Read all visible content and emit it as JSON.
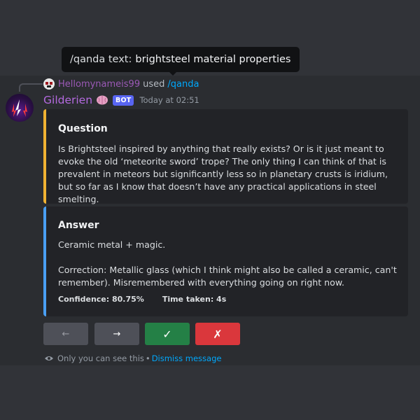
{
  "tooltip": {
    "prefix": "/qanda text:",
    "value": "brightsteel material properties"
  },
  "reply": {
    "username": "Hellomynameis99",
    "action": "used",
    "command": "/qanda"
  },
  "message": {
    "author": "Gilderien",
    "author_emoji": "brain-emoji",
    "badge": "BOT",
    "timestamp": "Today at 02:51"
  },
  "question_embed": {
    "accent": "#f0b232",
    "title": "Question",
    "body": "Is Brightsteel inspired by anything that really exists? Or is it just meant to evoke the old ‘meteorite sword’ trope? The only thing I can think of that is prevalent in meteors but significantly less so in planetary crusts is iridium, but so far as I know that doesn’t have any practical applications in steel smelting."
  },
  "answer_embed": {
    "accent": "#4a9ff3",
    "title": "Answer",
    "body_line1": "Ceramic metal + magic.",
    "body_line2": "Correction: Metallic glass (which I think might also be called a ceramic, can't remember). Misremembered with everything going on right now.",
    "confidence": "Confidence: 80.75%",
    "time_taken": "Time taken: 4s"
  },
  "buttons": {
    "prev": "←",
    "next": "→",
    "accept": "✓",
    "reject": "✗"
  },
  "ephemeral": {
    "note": "Only you can see this",
    "separator": "•",
    "dismiss": "Dismiss message"
  }
}
